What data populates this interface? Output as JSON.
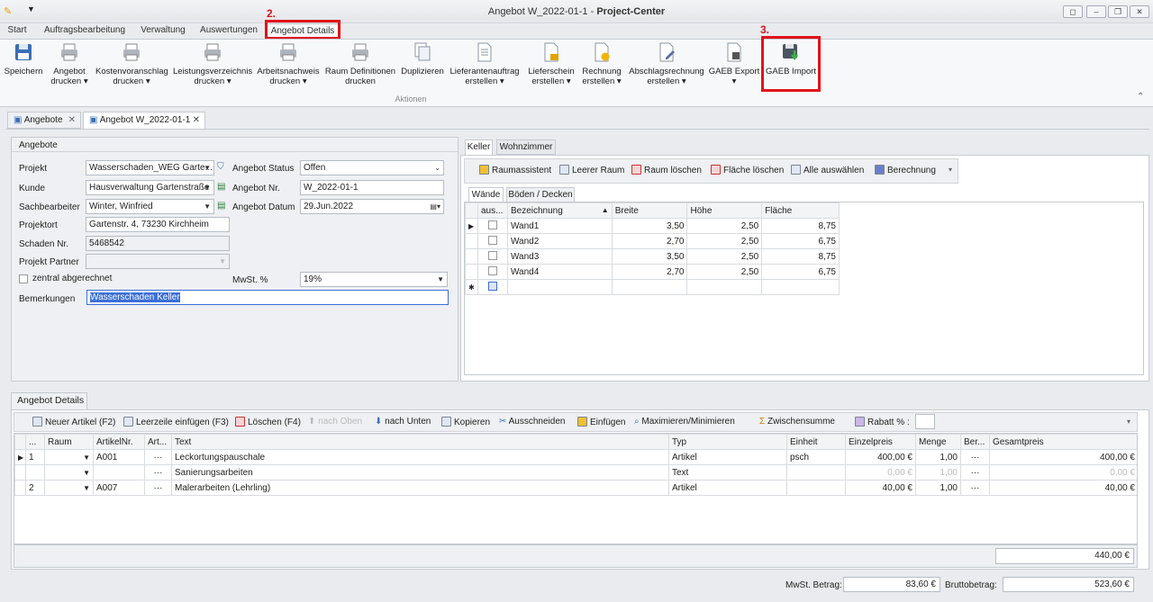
{
  "window": {
    "title_prefix": "Angebot W_2022-01-1 - ",
    "title_app": "Project-Center"
  },
  "menu_tabs": [
    "Start",
    "Auftragsbearbeitung",
    "Verwaltung",
    "Auswertungen",
    "Angebot Details"
  ],
  "annotations": {
    "step2": "2.",
    "step3": "3."
  },
  "ribbon": {
    "buttons": [
      {
        "l1": "Speichern",
        "l2": ""
      },
      {
        "l1": "Angebot",
        "l2": "drucken ▾"
      },
      {
        "l1": "Kostenvoranschlag",
        "l2": "drucken ▾"
      },
      {
        "l1": "Leistungsverzeichnis",
        "l2": "drucken ▾"
      },
      {
        "l1": "Arbeitsnachweis",
        "l2": "drucken ▾"
      },
      {
        "l1": "Raum Definitionen",
        "l2": "drucken"
      },
      {
        "l1": "Duplizieren",
        "l2": ""
      },
      {
        "l1": "Lieferantenauftrag",
        "l2": "erstellen ▾"
      },
      {
        "l1": "Lieferschein",
        "l2": "erstellen ▾"
      },
      {
        "l1": "Rechnung",
        "l2": "erstellen ▾"
      },
      {
        "l1": "Abschlagsrechnung",
        "l2": "erstellen ▾"
      },
      {
        "l1": "GAEB Export",
        "l2": "▾"
      },
      {
        "l1": "GAEB Import",
        "l2": ""
      }
    ],
    "group_label": "Aktionen"
  },
  "doc_tabs": [
    "Angebote",
    "Angebot W_2022-01-1"
  ],
  "angebote": {
    "header": "Angebote",
    "projekt_label": "Projekt",
    "projekt": "Wasserschaden_WEG Garte...",
    "kunde_label": "Kunde",
    "kunde": "Hausverwaltung Gartenstraße",
    "sachbearbeiter_label": "Sachbearbeiter",
    "sachbearbeiter": "Winter, Winfried",
    "projektort_label": "Projektort",
    "projektort": "Gartenstr. 4, 73230 Kirchheim",
    "schaden_label": "Schaden Nr.",
    "schaden": "5468542",
    "partner_label": "Projekt Partner",
    "partner": "",
    "zentral_label": "zentral abgerechnet",
    "status_label": "Angebot Status",
    "status": "Offen",
    "nr_label": "Angebot Nr.",
    "nr": "W_2022-01-1",
    "datum_label": "Angebot Datum",
    "datum": "29.Jun.2022",
    "mwst_label": "MwSt. %",
    "mwst": "19%",
    "bem_label": "Bemerkungen",
    "bem": "Wasserschaden Keller"
  },
  "rooms": {
    "tabs": [
      "Keller",
      "Wohnzimmer"
    ],
    "toolbar": [
      "Raumassistent",
      "Leerer Raum",
      "Raum löschen",
      "Fläche löschen",
      "Alle auswählen",
      "Berechnung"
    ],
    "subtabs": [
      "Wände",
      "Böden / Decken"
    ],
    "columns": [
      "aus...",
      "Bezeichnung",
      "Breite",
      "Höhe",
      "Fläche"
    ],
    "rows": [
      {
        "name": "Wand1",
        "b": "3,50",
        "h": "2,50",
        "f": "8,75"
      },
      {
        "name": "Wand2",
        "b": "2,70",
        "h": "2,50",
        "f": "6,75"
      },
      {
        "name": "Wand3",
        "b": "3,50",
        "h": "2,50",
        "f": "8,75"
      },
      {
        "name": "Wand4",
        "b": "2,70",
        "h": "2,50",
        "f": "6,75"
      }
    ]
  },
  "details": {
    "tab": "Angebot Details",
    "toolbar": [
      "Neuer Artikel (F2)",
      "Leerzeile einfügen (F3)",
      "Löschen (F4)",
      "nach Oben",
      "nach Unten",
      "Kopieren",
      "Ausschneiden",
      "Einfügen",
      "Maximieren/Minimieren",
      "Zwischensumme",
      "Rabatt % :"
    ],
    "columns": [
      "...",
      "Raum",
      "ArtikelNr.",
      "Art...",
      "Text",
      "Typ",
      "Einheit",
      "Einzelpreis",
      "Menge",
      "Ber...",
      "Gesamtpreis"
    ],
    "rows": [
      {
        "pos": "1",
        "art": "A001",
        "text": "Leckortungspauschale",
        "typ": "Artikel",
        "einheit": "psch",
        "ep": "400,00 €",
        "menge": "1,00",
        "gp": "400,00 €",
        "ghost": false
      },
      {
        "pos": "",
        "art": "",
        "text": "Sanierungsarbeiten",
        "typ": "Text",
        "einheit": "",
        "ep": "0,00 €",
        "menge": "1,00",
        "gp": "0,00 €",
        "ghost": true
      },
      {
        "pos": "2",
        "art": "A007",
        "text": "Malerarbeiten (Lehrling)",
        "typ": "Artikel",
        "einheit": "",
        "ep": "40,00 €",
        "menge": "1,00",
        "gp": "40,00 €",
        "ghost": false
      }
    ],
    "sum": "440,00 €"
  },
  "footer": {
    "mwst_label": "MwSt. Betrag:",
    "mwst": "83,60 €",
    "brutto_label": "Bruttobetrag:",
    "brutto": "523,60 €"
  },
  "colors": {
    "accent_red": "#e0131a",
    "selection_blue": "#3b6fd8"
  }
}
